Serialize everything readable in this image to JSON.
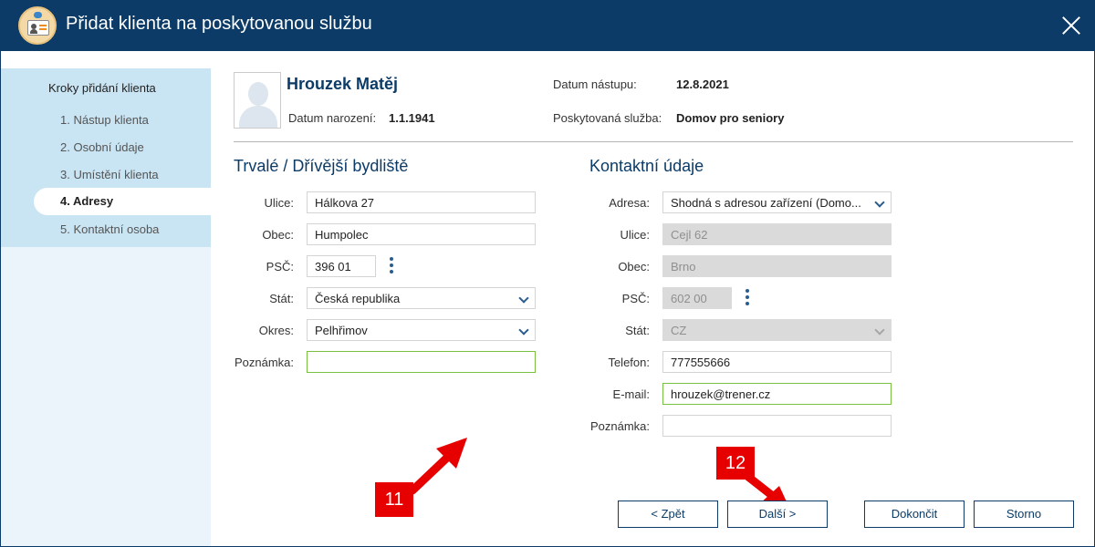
{
  "window": {
    "title": "Přidat klienta na poskytovanou službu"
  },
  "steps": {
    "title": "Kroky přidání klienta",
    "items": [
      {
        "label": "1. Nástup klienta"
      },
      {
        "label": "2. Osobní údaje"
      },
      {
        "label": "3. Umístění klienta"
      },
      {
        "label": "4. Adresy",
        "active": true
      },
      {
        "label": "5. Kontaktní osoba"
      }
    ]
  },
  "client": {
    "name": "Hrouzek Matěj",
    "birth_label": "Datum narození:",
    "birth_value": "1.1.1941",
    "start_label": "Datum nástupu:",
    "start_value": "12.8.2021",
    "service_label": "Poskytovaná služba:",
    "service_value": "Domov pro seniory"
  },
  "address": {
    "title": "Trvalé / Dřívější bydliště",
    "street_label": "Ulice:",
    "street": "Hálkova 27",
    "city_label": "Obec:",
    "city": "Humpolec",
    "zip_label": "PSČ:",
    "zip": "396 01",
    "country_label": "Stát:",
    "country": "Česká republika",
    "district_label": "Okres:",
    "district": "Pelhřimov",
    "note_label": "Poznámka:",
    "note": ""
  },
  "contact": {
    "title": "Kontaktní údaje",
    "address_label": "Adresa:",
    "address": "Shodná s adresou zařízení (Domo...",
    "street_label": "Ulice:",
    "street": "Cejl 62",
    "city_label": "Obec:",
    "city": "Brno",
    "zip_label": "PSČ:",
    "zip": "602 00",
    "country_label": "Stát:",
    "country": "CZ",
    "phone_label": "Telefon:",
    "phone": "777555666",
    "email_label": "E-mail:",
    "email": "hrouzek@trener.cz",
    "note_label": "Poznámka:",
    "note": ""
  },
  "annotations": {
    "badge_11": "11",
    "badge_12": "12",
    "color": "#e60000"
  },
  "buttons": {
    "back": "< Zpět",
    "next": "Další >",
    "finish": "Dokončit",
    "cancel": "Storno"
  },
  "colors": {
    "titlebar": "#0b3b66",
    "accent": "#0b3b66",
    "focus": "#7ac143"
  }
}
